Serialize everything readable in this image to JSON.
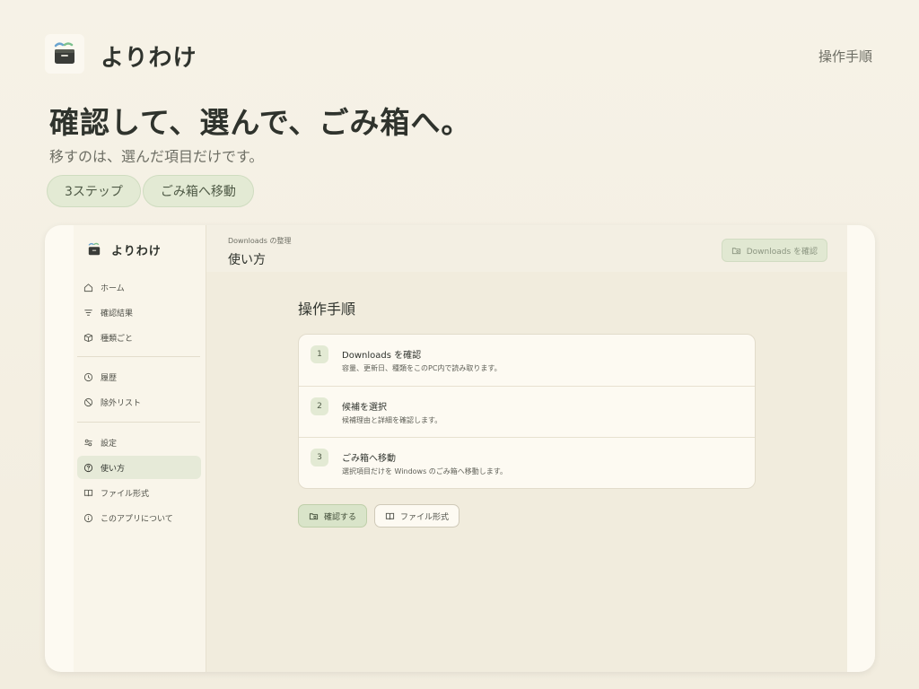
{
  "site": {
    "brand": "よりわけ",
    "nav_link": "操作手順",
    "hero_title": "確認して、選んで、ごみ箱へ。",
    "hero_subtitle": "移すのは、選んだ項目だけです。",
    "pills": [
      "3ステップ",
      "ごみ箱へ移動"
    ]
  },
  "app": {
    "brand": "よりわけ",
    "sidebar": {
      "group1": [
        {
          "label": "ホーム",
          "icon": "home-icon"
        },
        {
          "label": "確認結果",
          "icon": "filter-icon"
        },
        {
          "label": "種類ごと",
          "icon": "box-icon"
        }
      ],
      "group2": [
        {
          "label": "履歴",
          "icon": "history-icon"
        },
        {
          "label": "除外リスト",
          "icon": "ban-icon"
        }
      ],
      "group3": [
        {
          "label": "設定",
          "icon": "settings-icon"
        },
        {
          "label": "使い方",
          "icon": "help-icon",
          "active": true
        },
        {
          "label": "ファイル形式",
          "icon": "book-icon"
        },
        {
          "label": "このアプリについて",
          "icon": "info-icon"
        }
      ]
    },
    "header": {
      "breadcrumb": "Downloads の整理",
      "title": "使い方",
      "check_button": "Downloads を確認"
    },
    "section_title": "操作手順",
    "steps": [
      {
        "num": "1",
        "title": "Downloads を確認",
        "desc": "容量、更新日、種類をこのPC内で読み取ります。"
      },
      {
        "num": "2",
        "title": "候補を選択",
        "desc": "候補理由と詳細を確認します。"
      },
      {
        "num": "3",
        "title": "ごみ箱へ移動",
        "desc": "選択項目だけを Windows のごみ箱へ移動します。"
      }
    ],
    "buttons": {
      "confirm": "確認する",
      "file_types": "ファイル形式"
    }
  },
  "colors": {
    "accent_green": "#e3ead4",
    "primary_button": "#d9e4c9",
    "background": "#f6f2e7"
  }
}
